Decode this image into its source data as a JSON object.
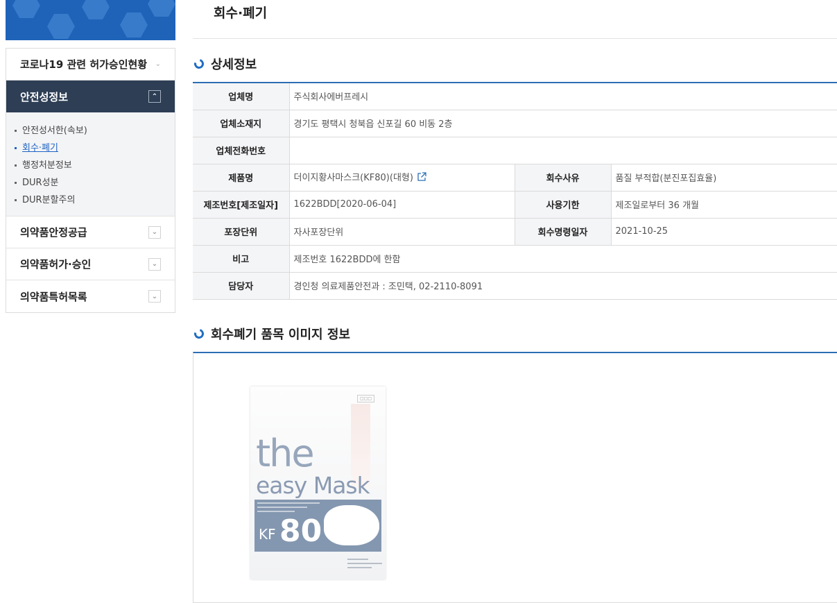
{
  "sidebar": {
    "items": [
      {
        "label": "코로나19 관련 허가승인현황"
      },
      {
        "label": "안전성정보"
      },
      {
        "label": "의약품안정공급"
      },
      {
        "label": "의약품허가·승인"
      },
      {
        "label": "의약품특허목록"
      }
    ],
    "submenu": [
      {
        "label": "안전성서한(속보)"
      },
      {
        "label": "회수·폐기"
      },
      {
        "label": "행정처분정보"
      },
      {
        "label": "DUR성분"
      },
      {
        "label": "DUR분할주의"
      }
    ]
  },
  "page": {
    "title": "회수·폐기",
    "section_detail": "상세정보",
    "section_image": "회수폐기 품목 이미지 정보"
  },
  "detail": {
    "company_label": "업체명",
    "company": "주식회사에버프레시",
    "address_label": "업체소재지",
    "address": "경기도 평택시 청북읍 신포길 60 비동 2층",
    "phone_label": "업체전화번호",
    "phone": "",
    "product_label": "제품명",
    "product": "더이지황사마스크(KF80)(대형)",
    "reason_label": "회수사유",
    "reason": "품질 부적합(분진포집효율)",
    "lot_label": "제조번호[제조일자]",
    "lot": "1622BDD[2020-06-04]",
    "expiry_label": "사용기한",
    "expiry": "제조일로부터 36 개월",
    "pack_label": "포장단위",
    "pack": "자사포장단위",
    "order_date_label": "회수명령일자",
    "order_date": "2021-10-25",
    "note_label": "비고",
    "note": "제조번호 1622BDD에 한함",
    "contact_label": "담당자",
    "contact": "경인청 의료제품안전과 : 조민택, 02-2110-8091"
  },
  "product_image": {
    "line1": "the",
    "line2": "easy Mask",
    "kf": "KF",
    "grade": "80"
  },
  "colors": {
    "active_nav_bg": "#2d3e55",
    "accent": "#2b6db3",
    "link": "#1f63c4"
  },
  "icons": {
    "external_link": "external-link-icon",
    "chevron": "chevron-down-icon",
    "section_marker": "refresh-ring-icon"
  }
}
